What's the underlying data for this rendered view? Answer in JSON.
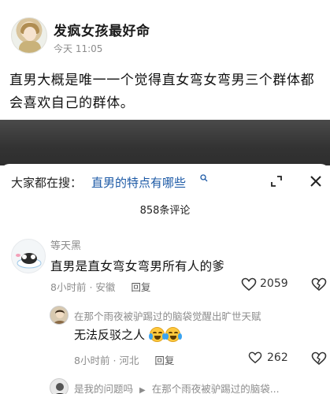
{
  "post": {
    "author": "发疯女孩最好命",
    "time": "今天 11:05",
    "text": "直男大概是唯一一个觉得直女弯女弯男三个群体都会喜欢自己的群体。"
  },
  "comments_sheet": {
    "search_prefix": "大家都在搜：",
    "search_query": "直男的特点有哪些",
    "comment_count": "858条评论",
    "comments": [
      {
        "author": "等天黑",
        "text": "直男是直女弯女弯男所有人的爹",
        "time": "8小时前",
        "location": "安徽",
        "reply_label": "回复",
        "likes": "2059"
      }
    ],
    "replies": [
      {
        "author": "在那个雨夜被驴踢过的脑袋觉醒出旷世天赋",
        "text": "无法反驳之人",
        "time": "8小时前",
        "location": "河北",
        "reply_label": "回复",
        "likes": "262"
      },
      {
        "author": "是我的问题吗",
        "reply_to": "在那个雨夜被驴踢过的脑袋..."
      }
    ]
  },
  "colors": {
    "search_query": "#1d5aa6",
    "meta_gray": "#8c8c8c",
    "overlay": "#333333"
  },
  "icons": [
    "search-icon",
    "expand-icon",
    "close-icon",
    "heart-icon",
    "dislike-icon",
    "crying-laughing-emoji"
  ]
}
